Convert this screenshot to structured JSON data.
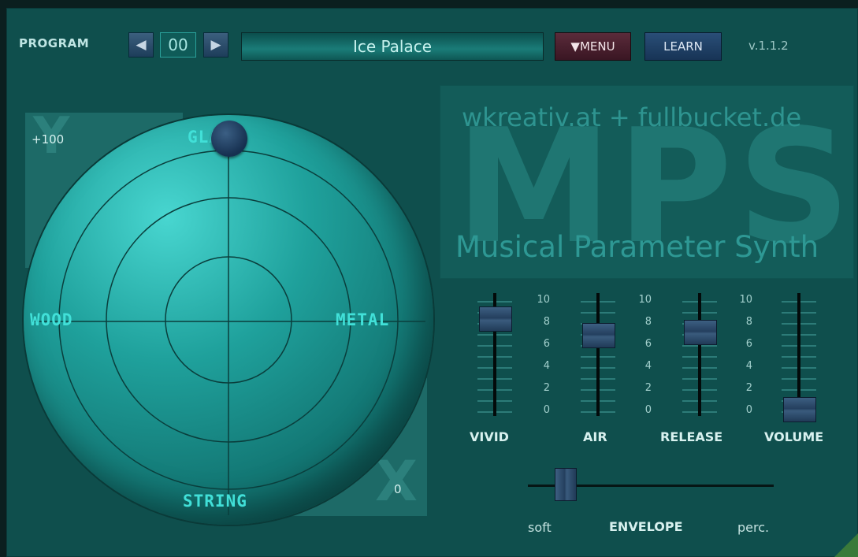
{
  "header": {
    "program_label": "PROGRAM",
    "prev_icon": "◀",
    "program_number": "00",
    "next_icon": "▶",
    "program_name": "Ice Palace",
    "menu_label": "▼MENU",
    "learn_label": "LEARN",
    "version": "v.1.1.2"
  },
  "pad": {
    "y_axis_letter": "Y",
    "x_axis_letter": "X",
    "y_max_label": "+100",
    "x_min_label": "0",
    "labels": {
      "top": "GLASS",
      "left": "WOOD",
      "right": "METAL",
      "bottom": "STRING"
    }
  },
  "logo": {
    "url": "wkreativ.at + fullbucket.de",
    "mark": "MPS",
    "subtitle": "Musical Parameter Synth"
  },
  "sliders": [
    {
      "name": "VIVID",
      "value": 8.4,
      "scale": [
        "10",
        "8",
        "6",
        "4",
        "2",
        "0"
      ]
    },
    {
      "name": "AIR",
      "value": 6.9,
      "scale": [
        "10",
        "8",
        "6",
        "4",
        "2",
        "0"
      ]
    },
    {
      "name": "RELEASE",
      "value": 7.2,
      "scale": [
        "10",
        "8",
        "6",
        "4",
        "2",
        "0"
      ]
    },
    {
      "name": "VOLUME",
      "value": 0.2,
      "scale": []
    }
  ],
  "envelope": {
    "label": "ENVELOPE",
    "left_label": "soft",
    "right_label": "perc.",
    "value": 0.15
  },
  "colors": {
    "background": "#0f4f4d",
    "pad_label": "#41e0d8",
    "button_blue": "#2a4e78",
    "menu_red": "#5a2b3a"
  }
}
